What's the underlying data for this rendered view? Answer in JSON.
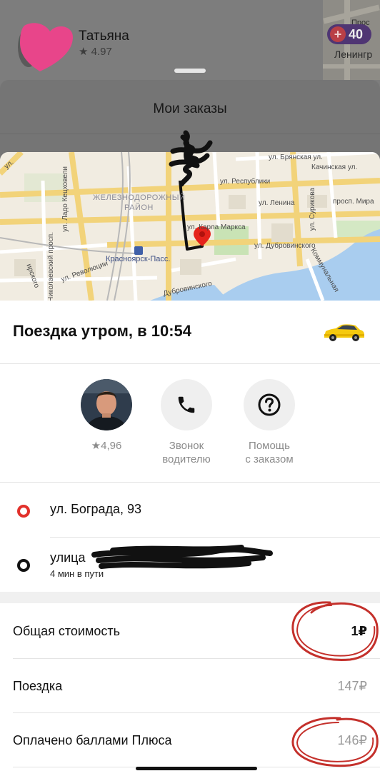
{
  "background": {
    "driver_name": "Татьяна",
    "driver_rating": "★ 4.97",
    "plus_points": "40",
    "map_label": "Ленингр",
    "map_label_top": "Прос"
  },
  "orders_sheet": {
    "title": "Мои заказы"
  },
  "map": {
    "labels": {
      "bryanskaya": "ул. Брянская ул.",
      "kachinskaya": "Качинская ул.",
      "lado": "ул. Ладо Кецховели",
      "respubliki": "ул. Республики",
      "district_1": "ЖЕЛЕЗНОДОРОЖНЫЙ",
      "district_2": "РАЙОН",
      "lenina": "ул. Ленина",
      "surikova": "ул. Сурикова",
      "mira": "просп. Мира",
      "marksa": "ул. Карла Маркса",
      "dubrovinskogo": "ул. Дубровинского",
      "nikolaevsky": "Николаевский просп.",
      "revolyutsii": "ул. Революции",
      "station": "Красноярск-Пасс.",
      "kommun": "Коммунальная",
      "chkalova": "Бограда",
      "dubrovinskogo2": "Дубровинского",
      "elisk": "ирского",
      "ulitsa_left": "ул."
    }
  },
  "trip": {
    "title": "Поездка утром, в 10:54"
  },
  "actions": {
    "driver_rating": "★4,96",
    "call_line1": "Звонок",
    "call_line2": "водителю",
    "help_line1": "Помощь",
    "help_line2": "с заказом"
  },
  "route": {
    "from": "ул. Бограда, 93",
    "to": "улица",
    "eta": "4 мин в пути"
  },
  "cost": {
    "total_label": "Общая стоимость",
    "total_value": "1₽",
    "trip_label": "Поездка",
    "trip_value": "147₽",
    "plus_label": "Оплачено баллами Плюса",
    "plus_value": "146₽"
  },
  "colors": {
    "route_start": "#e2312b",
    "route_end": "#111111",
    "map_pin": "#e5231b",
    "annotation": "#c4302b"
  }
}
